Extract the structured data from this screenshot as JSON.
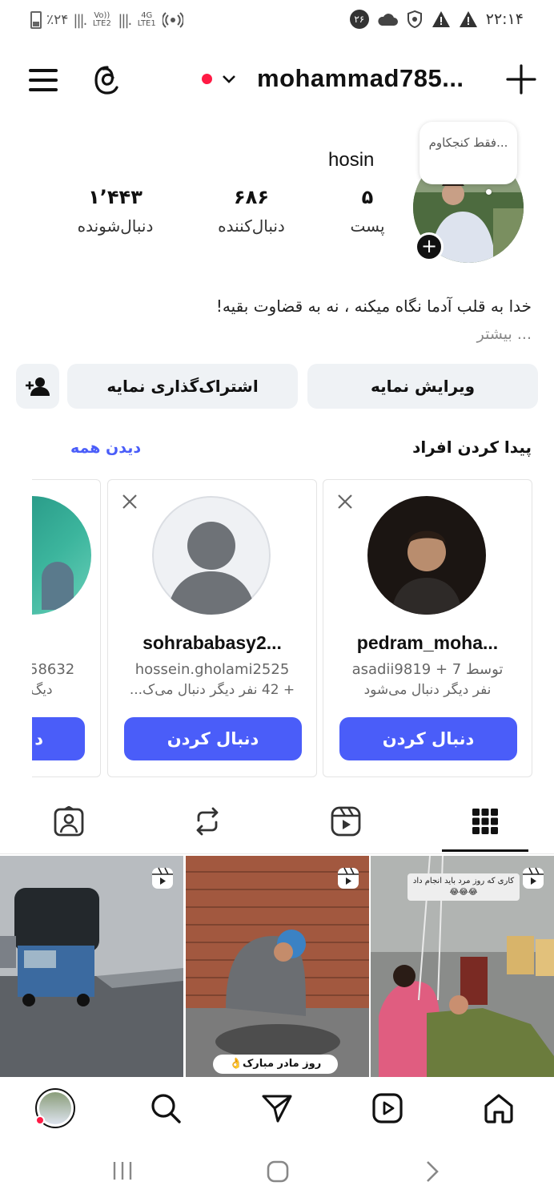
{
  "status_bar": {
    "battery_percent": "٪۲۴",
    "net1": "Vo)) LTE2",
    "net2": "4G LTE1",
    "notification_count": "۲۶",
    "time": "۲۲:۱۴"
  },
  "header": {
    "username": "mohammad785..."
  },
  "profile": {
    "note": "فقط کنجکاوم...",
    "display_name": "hosin",
    "stats": [
      {
        "value": "۵",
        "label": "پست"
      },
      {
        "value": "۶۸۶",
        "label": "دنبال‌کننده"
      },
      {
        "value": "۱٬۴۴۳",
        "label": "دنبال‌شونده"
      }
    ],
    "bio": "خدا به قلب آدما نگاه میکنه ، نه به قضاوت بقیه!",
    "bio_more": "... بیشتر"
  },
  "actions": {
    "edit_profile": "ویرایش نمایه",
    "share_profile": "اشتراک‌گذاری نمایه"
  },
  "discover": {
    "title": "پیدا کردن افراد",
    "see_all": "دیدن همه",
    "cards": [
      {
        "username": "pedram_moha...",
        "line1": "توسط asadii9819 + 7",
        "line2": "نفر دیگر دنبال می‌شود",
        "follow": "دنبال کردن"
      },
      {
        "username": "sohrababasy2...",
        "line1": "hossein.gholami2525",
        "line2": "+ 42 نفر دیگر دنبال می‌ک...",
        "follow": "دنبال کردن"
      },
      {
        "line1": "58632",
        "line2": "دیگ",
        "follow": "د"
      }
    ]
  },
  "grid": {
    "post2_caption": "روز مادر مبارک👌",
    "post3_caption": "کاری که روز مرد باید انجام داد 😂😂😂"
  }
}
